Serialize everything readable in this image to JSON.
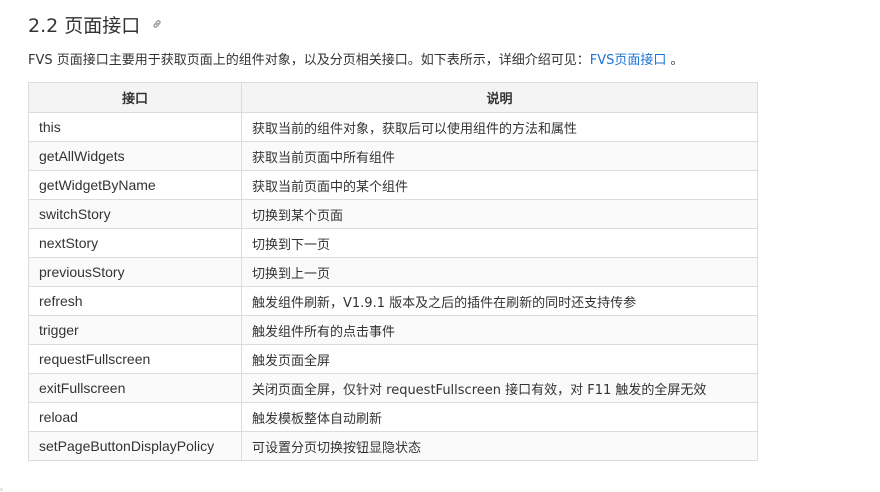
{
  "heading": {
    "title": "2.2 页面接口",
    "anchor_icon": "link-icon"
  },
  "intro": {
    "text_before": "FVS 页面接口主要用于获取页面上的组件对象，以及分页相关接口。如下表所示，详细介绍可见：",
    "link_label": "FVS页面接口",
    "text_after": " 。"
  },
  "table": {
    "headers": [
      "接口",
      "说明"
    ],
    "rows": [
      {
        "name": "this",
        "desc": "获取当前的组件对象，获取后可以使用组件的方法和属性"
      },
      {
        "name": "getAllWidgets",
        "desc": "获取当前页面中所有组件"
      },
      {
        "name": "getWidgetByName",
        "desc": "获取当前页面中的某个组件"
      },
      {
        "name": "switchStory",
        "desc": "切换到某个页面"
      },
      {
        "name": "nextStory",
        "desc": "切换到下一页"
      },
      {
        "name": "previousStory",
        "desc": "切换到上一页"
      },
      {
        "name": "refresh",
        "desc": "触发组件刷新，V1.9.1 版本及之后的插件在刷新的同时还支持传参"
      },
      {
        "name": "trigger",
        "desc": "触发组件所有的点击事件"
      },
      {
        "name": "requestFullscreen",
        "desc": "触发页面全屏"
      },
      {
        "name": "exitFullscreen",
        "desc": "关闭页面全屏，仅针对 requestFullscreen 接口有效，对 F11 触发的全屏无效"
      },
      {
        "name": "reload",
        "desc": "触发模板整体自动刷新"
      },
      {
        "name": "setPageButtonDisplayPolicy",
        "desc": "可设置分页切换按钮显隐状态"
      }
    ]
  },
  "colors": {
    "link": "#1e73d8",
    "border": "#dcdcdc",
    "header_bg": "#f4f4f4",
    "text": "#333333"
  }
}
